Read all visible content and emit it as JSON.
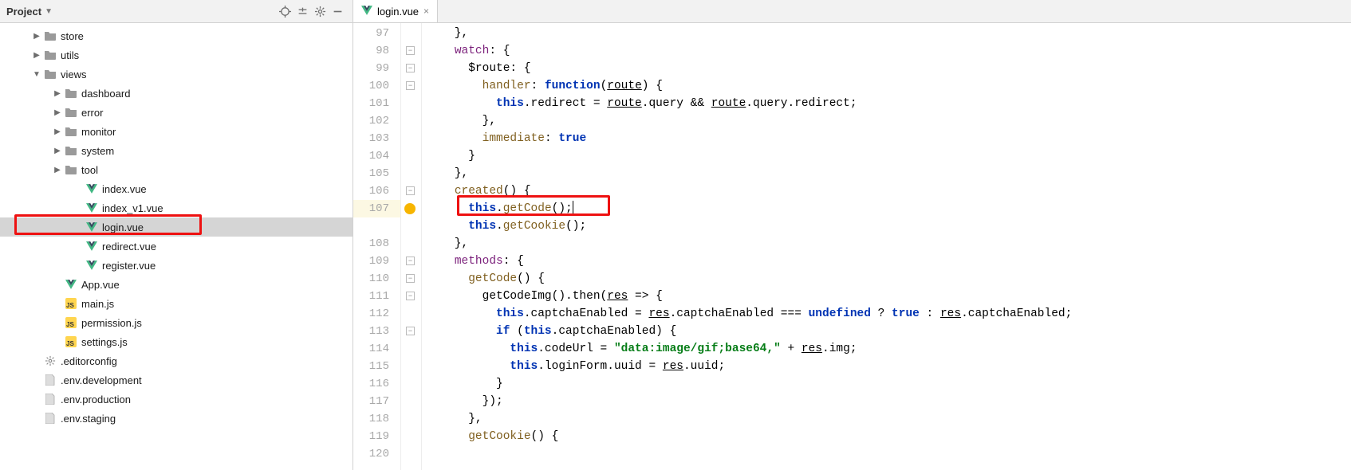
{
  "panel": {
    "title": "Project"
  },
  "tree": {
    "rows": [
      {
        "indent": 40,
        "arrow": "right",
        "icon": "folder",
        "label": "store"
      },
      {
        "indent": 40,
        "arrow": "right",
        "icon": "folder",
        "label": "utils"
      },
      {
        "indent": 40,
        "arrow": "down",
        "icon": "folder",
        "label": "views"
      },
      {
        "indent": 66,
        "arrow": "right",
        "icon": "folder",
        "label": "dashboard"
      },
      {
        "indent": 66,
        "arrow": "right",
        "icon": "folder",
        "label": "error"
      },
      {
        "indent": 66,
        "arrow": "right",
        "icon": "folder",
        "label": "monitor"
      },
      {
        "indent": 66,
        "arrow": "right",
        "icon": "folder",
        "label": "system"
      },
      {
        "indent": 66,
        "arrow": "right",
        "icon": "folder",
        "label": "tool"
      },
      {
        "indent": 92,
        "arrow": "",
        "icon": "vue",
        "label": "index.vue"
      },
      {
        "indent": 92,
        "arrow": "",
        "icon": "vue",
        "label": "index_v1.vue"
      },
      {
        "indent": 92,
        "arrow": "",
        "icon": "vue",
        "label": "login.vue",
        "selected": true,
        "highlight": true
      },
      {
        "indent": 92,
        "arrow": "",
        "icon": "vue",
        "label": "redirect.vue"
      },
      {
        "indent": 92,
        "arrow": "",
        "icon": "vue",
        "label": "register.vue"
      },
      {
        "indent": 66,
        "arrow": "",
        "icon": "vue",
        "label": "App.vue"
      },
      {
        "indent": 66,
        "arrow": "",
        "icon": "js",
        "label": "main.js"
      },
      {
        "indent": 66,
        "arrow": "",
        "icon": "js",
        "label": "permission.js"
      },
      {
        "indent": 66,
        "arrow": "",
        "icon": "js",
        "label": "settings.js"
      },
      {
        "indent": 40,
        "arrow": "",
        "icon": "gear",
        "label": ".editorconfig"
      },
      {
        "indent": 40,
        "arrow": "",
        "icon": "txt",
        "label": ".env.development"
      },
      {
        "indent": 40,
        "arrow": "",
        "icon": "txt",
        "label": ".env.production"
      },
      {
        "indent": 40,
        "arrow": "",
        "icon": "txt",
        "label": ".env.staging"
      }
    ]
  },
  "tab": {
    "label": "login.vue"
  },
  "gutter": {
    "start": 97,
    "end": 120,
    "highlight": 107
  },
  "code": {
    "highlight_index": 10,
    "lines": [
      {
        "segs": [
          {
            "t": "    },",
            "c": "pun"
          }
        ]
      },
      {
        "segs": [
          {
            "t": "    ",
            "c": ""
          },
          {
            "t": "watch",
            "c": "kwp"
          },
          {
            "t": ": {",
            "c": "pun"
          }
        ]
      },
      {
        "segs": [
          {
            "t": "      $route: {",
            "c": "pun"
          }
        ]
      },
      {
        "segs": [
          {
            "t": "        ",
            "c": ""
          },
          {
            "t": "handler",
            "c": "prp"
          },
          {
            "t": ": ",
            "c": "pun"
          },
          {
            "t": "function",
            "c": "kb"
          },
          {
            "t": "(",
            "c": "pun"
          },
          {
            "t": "route",
            "c": "und"
          },
          {
            "t": ") {",
            "c": "pun"
          }
        ]
      },
      {
        "segs": [
          {
            "t": "          ",
            "c": ""
          },
          {
            "t": "this",
            "c": "kb"
          },
          {
            "t": ".redirect = ",
            "c": "pun"
          },
          {
            "t": "route",
            "c": "und"
          },
          {
            "t": ".query && ",
            "c": "pun"
          },
          {
            "t": "route",
            "c": "und"
          },
          {
            "t": ".query.redirect;",
            "c": "pun"
          }
        ]
      },
      {
        "segs": [
          {
            "t": "        },",
            "c": "pun"
          }
        ]
      },
      {
        "segs": [
          {
            "t": "        ",
            "c": ""
          },
          {
            "t": "immediate",
            "c": "prp"
          },
          {
            "t": ": ",
            "c": "pun"
          },
          {
            "t": "true",
            "c": "kb"
          }
        ]
      },
      {
        "segs": [
          {
            "t": "      }",
            "c": "pun"
          }
        ]
      },
      {
        "segs": [
          {
            "t": "    },",
            "c": "pun"
          }
        ]
      },
      {
        "segs": [
          {
            "t": "    ",
            "c": ""
          },
          {
            "t": "created",
            "c": "prp"
          },
          {
            "t": "() {",
            "c": "pun"
          }
        ]
      },
      {
        "segs": [
          {
            "t": "      ",
            "c": ""
          },
          {
            "t": "this",
            "c": "kb"
          },
          {
            "t": ".",
            "c": "pun"
          },
          {
            "t": "getCode",
            "c": "prp"
          },
          {
            "t": "();",
            "c": "pun"
          }
        ],
        "caret_after": true,
        "red_box": true
      },
      {
        "segs": [
          {
            "t": "      ",
            "c": ""
          },
          {
            "t": "this",
            "c": "kb"
          },
          {
            "t": ".",
            "c": "pun"
          },
          {
            "t": "getCookie",
            "c": "prp"
          },
          {
            "t": "();",
            "c": "pun"
          }
        ]
      },
      {
        "segs": [
          {
            "t": "    },",
            "c": "pun"
          }
        ]
      },
      {
        "segs": [
          {
            "t": "    ",
            "c": ""
          },
          {
            "t": "methods",
            "c": "kwp"
          },
          {
            "t": ": {",
            "c": "pun"
          }
        ]
      },
      {
        "segs": [
          {
            "t": "      ",
            "c": ""
          },
          {
            "t": "getCode",
            "c": "prp"
          },
          {
            "t": "() {",
            "c": "pun"
          }
        ]
      },
      {
        "segs": [
          {
            "t": "        getCodeImg().then(",
            "c": "pun"
          },
          {
            "t": "res",
            "c": "und"
          },
          {
            "t": " => {",
            "c": "pun"
          }
        ]
      },
      {
        "segs": [
          {
            "t": "          ",
            "c": ""
          },
          {
            "t": "this",
            "c": "kb"
          },
          {
            "t": ".captchaEnabled = ",
            "c": "pun"
          },
          {
            "t": "res",
            "c": "und"
          },
          {
            "t": ".captchaEnabled === ",
            "c": "pun"
          },
          {
            "t": "undefined",
            "c": "kb"
          },
          {
            "t": " ? ",
            "c": "pun"
          },
          {
            "t": "true",
            "c": "kb"
          },
          {
            "t": " : ",
            "c": "pun"
          },
          {
            "t": "res",
            "c": "und"
          },
          {
            "t": ".captchaEnabled;",
            "c": "pun"
          }
        ]
      },
      {
        "segs": [
          {
            "t": "          ",
            "c": ""
          },
          {
            "t": "if ",
            "c": "kb"
          },
          {
            "t": "(",
            "c": "pun"
          },
          {
            "t": "this",
            "c": "kb"
          },
          {
            "t": ".captchaEnabled) {",
            "c": "pun"
          }
        ]
      },
      {
        "segs": [
          {
            "t": "            ",
            "c": ""
          },
          {
            "t": "this",
            "c": "kb"
          },
          {
            "t": ".codeUrl = ",
            "c": "pun"
          },
          {
            "t": "\"data:image/gif;base64,\"",
            "c": "str"
          },
          {
            "t": " + ",
            "c": "pun"
          },
          {
            "t": "res",
            "c": "und"
          },
          {
            "t": ".img;",
            "c": "pun"
          }
        ]
      },
      {
        "segs": [
          {
            "t": "            ",
            "c": ""
          },
          {
            "t": "this",
            "c": "kb"
          },
          {
            "t": ".loginForm.uuid = ",
            "c": "pun"
          },
          {
            "t": "res",
            "c": "und"
          },
          {
            "t": ".uuid;",
            "c": "pun"
          }
        ]
      },
      {
        "segs": [
          {
            "t": "          }",
            "c": "pun"
          }
        ]
      },
      {
        "segs": [
          {
            "t": "        });",
            "c": "pun"
          }
        ]
      },
      {
        "segs": [
          {
            "t": "      },",
            "c": "pun"
          }
        ]
      },
      {
        "segs": [
          {
            "t": "      ",
            "c": ""
          },
          {
            "t": "getCookie",
            "c": "prp"
          },
          {
            "t": "() {",
            "c": "pun"
          }
        ]
      }
    ]
  }
}
